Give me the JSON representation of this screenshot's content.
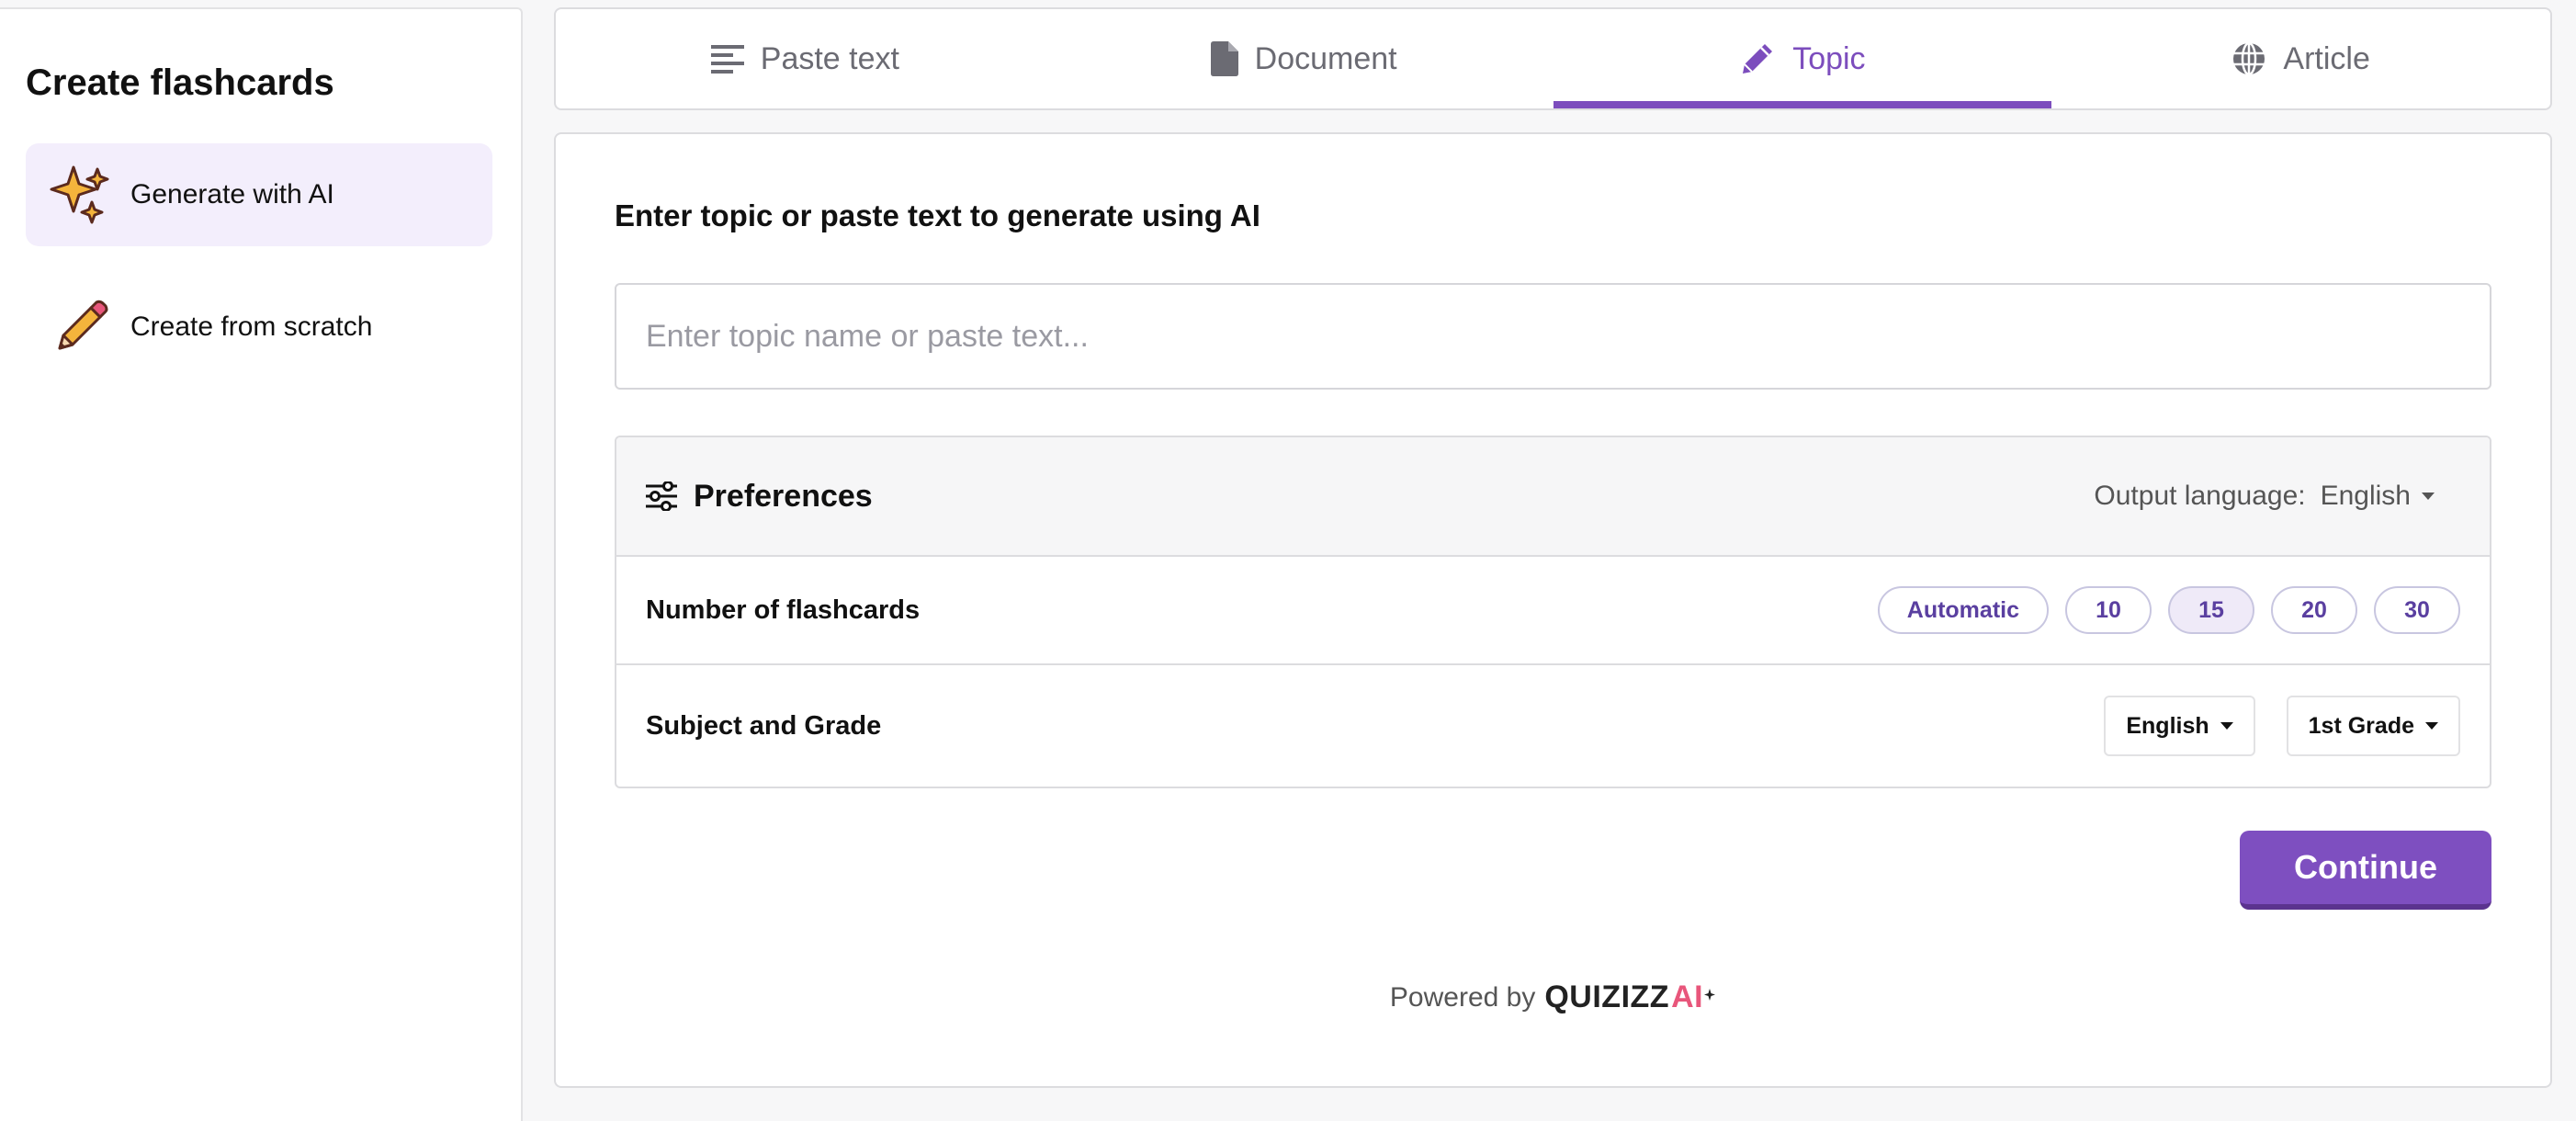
{
  "sidebar": {
    "title": "Create flashcards",
    "items": [
      {
        "label": "Generate with AI",
        "icon": "sparkles-icon"
      },
      {
        "label": "Create from scratch",
        "icon": "pencil-icon"
      }
    ]
  },
  "tabs": [
    {
      "label": "Paste text",
      "icon": "text-lines-icon"
    },
    {
      "label": "Document",
      "icon": "document-icon"
    },
    {
      "label": "Topic",
      "icon": "pencil-icon"
    },
    {
      "label": "Article",
      "icon": "globe-icon"
    }
  ],
  "main": {
    "prompt": "Enter topic or paste text to generate using AI",
    "input_placeholder": "Enter topic name or paste text...",
    "preferences": {
      "title": "Preferences",
      "output_language_label": "Output language:",
      "output_language_value": "English",
      "num_flashcards_label": "Number of flashcards",
      "num_options": [
        "Automatic",
        "10",
        "15",
        "20",
        "30"
      ],
      "selected_option": "15",
      "subject_grade_label": "Subject and Grade",
      "subject_value": "English",
      "grade_value": "1st Grade"
    },
    "continue_label": "Continue",
    "powered_by": "Powered by",
    "brand": "QUIZIZZ",
    "brand_ai": "AI"
  },
  "colors": {
    "accent": "#7c4dbd",
    "button": "#7e4fc0",
    "active_sidebar_bg": "#f3eefc"
  }
}
